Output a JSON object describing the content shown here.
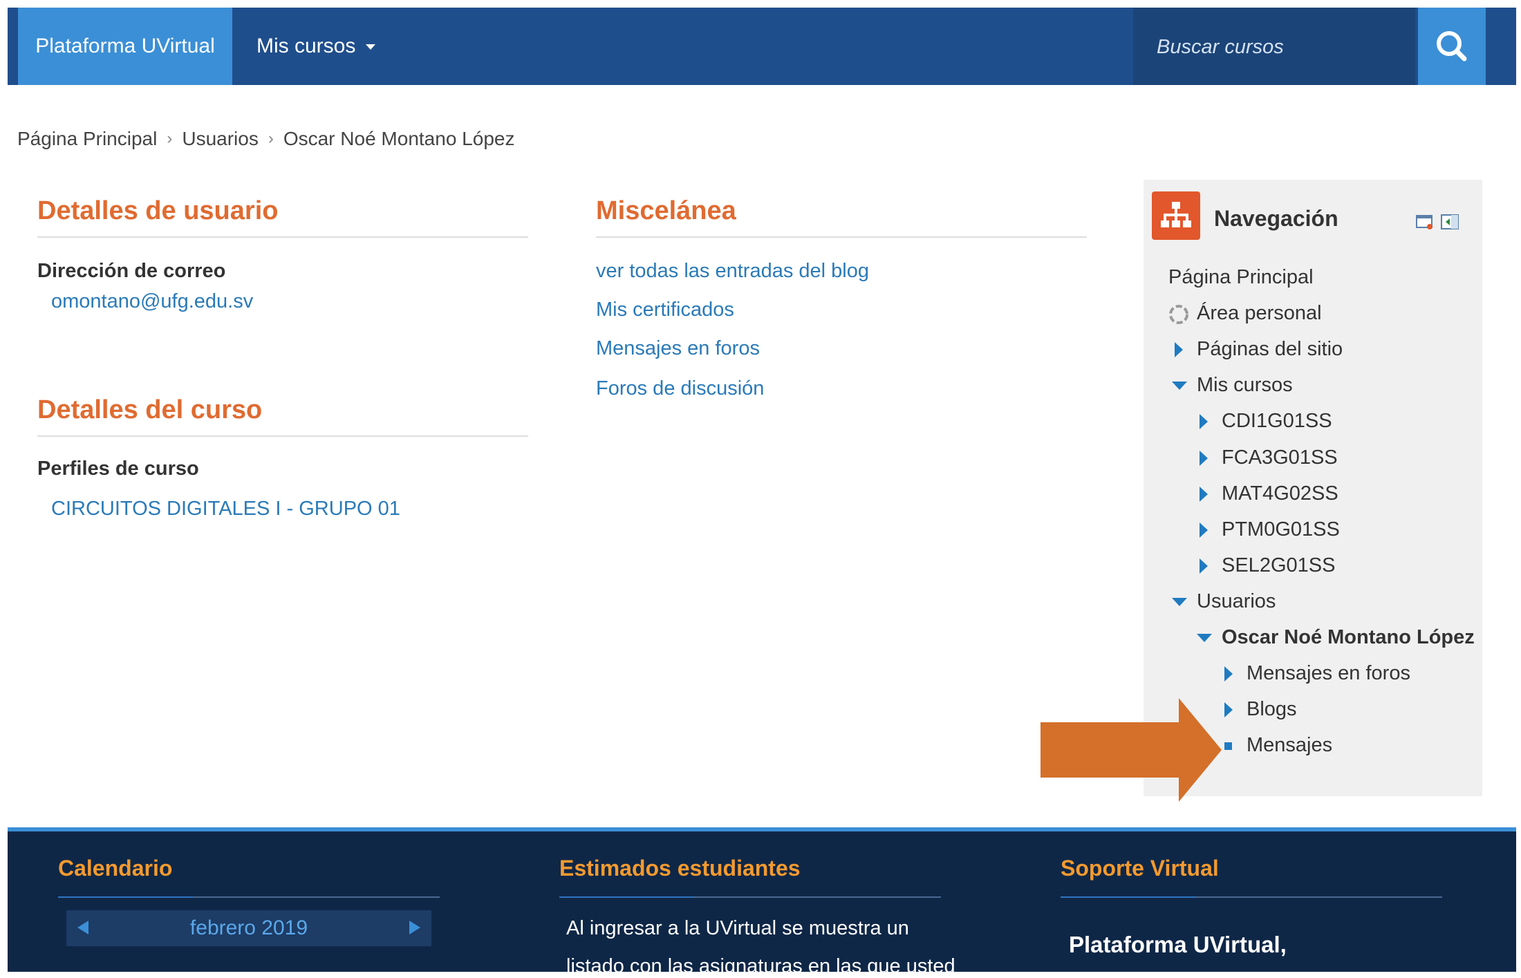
{
  "navbar": {
    "brand": "Plataforma UVirtual",
    "my_courses": "Mis cursos",
    "search_placeholder": "Buscar cursos"
  },
  "breadcrumb": [
    "Página Principal",
    "Usuarios",
    "Oscar Noé Montano López"
  ],
  "user_details": {
    "title": "Detalles de usuario",
    "email_label": "Dirección de correo",
    "email": "omontano@ufg.edu.sv"
  },
  "course_details": {
    "title": "Detalles del curso",
    "profiles_label": "Perfiles de curso",
    "course": "CIRCUITOS DIGITALES I - GRUPO 01"
  },
  "misc": {
    "title": "Miscelánea",
    "links": [
      "ver todas las entradas del blog",
      "Mis certificados",
      "Mensajes en foros",
      "Foros de discusión"
    ]
  },
  "navigation": {
    "title": "Navegación",
    "items": [
      "Página Principal",
      "Área personal",
      "Páginas del sitio",
      "Mis cursos",
      "CDI1G01SS",
      "FCA3G01SS",
      "MAT4G02SS",
      "PTM0G01SS",
      "SEL2G01SS",
      "Usuarios",
      "Oscar Noé Montano López",
      "Mensajes en foros",
      "Blogs",
      "Mensajes"
    ]
  },
  "footer": {
    "calendar_title": "Calendario",
    "calendar_month": "febrero 2019",
    "students_title": "Estimados estudiantes",
    "students_text_1": "Al ingresar a la UVirtual se muestra un",
    "students_text_2": "listado con las asignaturas en las que usted",
    "support_title": "Soporte Virtual",
    "support_text": "Plataforma UVirtual,"
  },
  "colors": {
    "navbar": "#1f4e8c",
    "brand_bg": "#3b8fd6",
    "section_title": "#e06b31",
    "link": "#2a7ab8",
    "annotation_arrow": "#d4702a",
    "footer_bg": "#0f2747",
    "footer_title": "#f39a2f"
  }
}
